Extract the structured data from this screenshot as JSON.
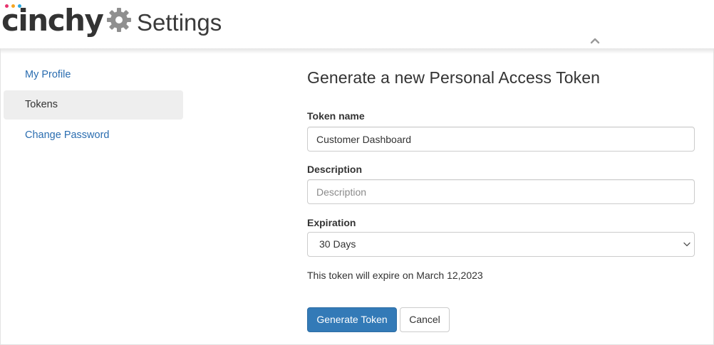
{
  "header": {
    "logo_text": "cinchy",
    "logo_dot_colors": [
      "#e8336e",
      "#f5a623",
      "#2aa8e0"
    ],
    "settings_icon": "gear-icon",
    "title": "Settings",
    "collapse_icon": "chevron-up-icon"
  },
  "sidebar": {
    "items": [
      {
        "label": "My Profile",
        "active": false
      },
      {
        "label": "Tokens",
        "active": true
      },
      {
        "label": "Change Password",
        "active": false
      }
    ]
  },
  "form": {
    "title": "Generate a new Personal Access Token",
    "token_name": {
      "label": "Token name",
      "value": "Customer Dashboard",
      "placeholder": "Token name"
    },
    "description": {
      "label": "Description",
      "value": "",
      "placeholder": "Description"
    },
    "expiration": {
      "label": "Expiration",
      "selected": "30 Days",
      "icon": "chevron-down-icon"
    },
    "expire_note": "This token will expire on March 12,2023",
    "generate_label": "Generate Token",
    "cancel_label": "Cancel"
  },
  "colors": {
    "link": "#2a6db0",
    "primary": "#337ab7",
    "active_nav_bg": "#eeeeee"
  }
}
